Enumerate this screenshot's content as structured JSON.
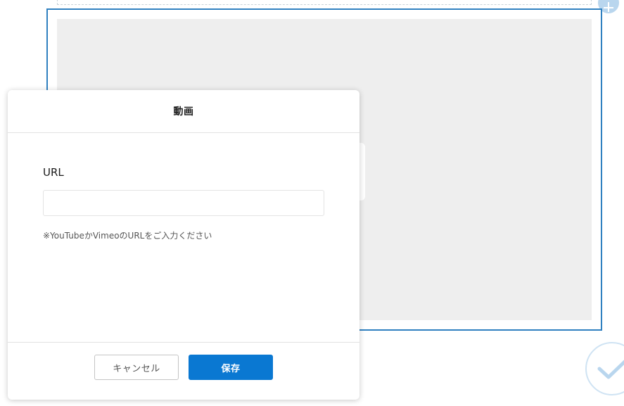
{
  "modal": {
    "title": "動画",
    "url_label": "URL",
    "url_value": "",
    "url_placeholder": "",
    "hint": "※YouTubeかVimeoのURLをご入力ください",
    "cancel_label": "キャンセル",
    "save_label": "保存"
  },
  "colors": {
    "accent": "#0a78d2",
    "selection_border": "#2f80c0",
    "placeholder_bg": "#eeeeee"
  },
  "icons": {
    "add": "plus-icon",
    "confirm": "check-icon"
  }
}
